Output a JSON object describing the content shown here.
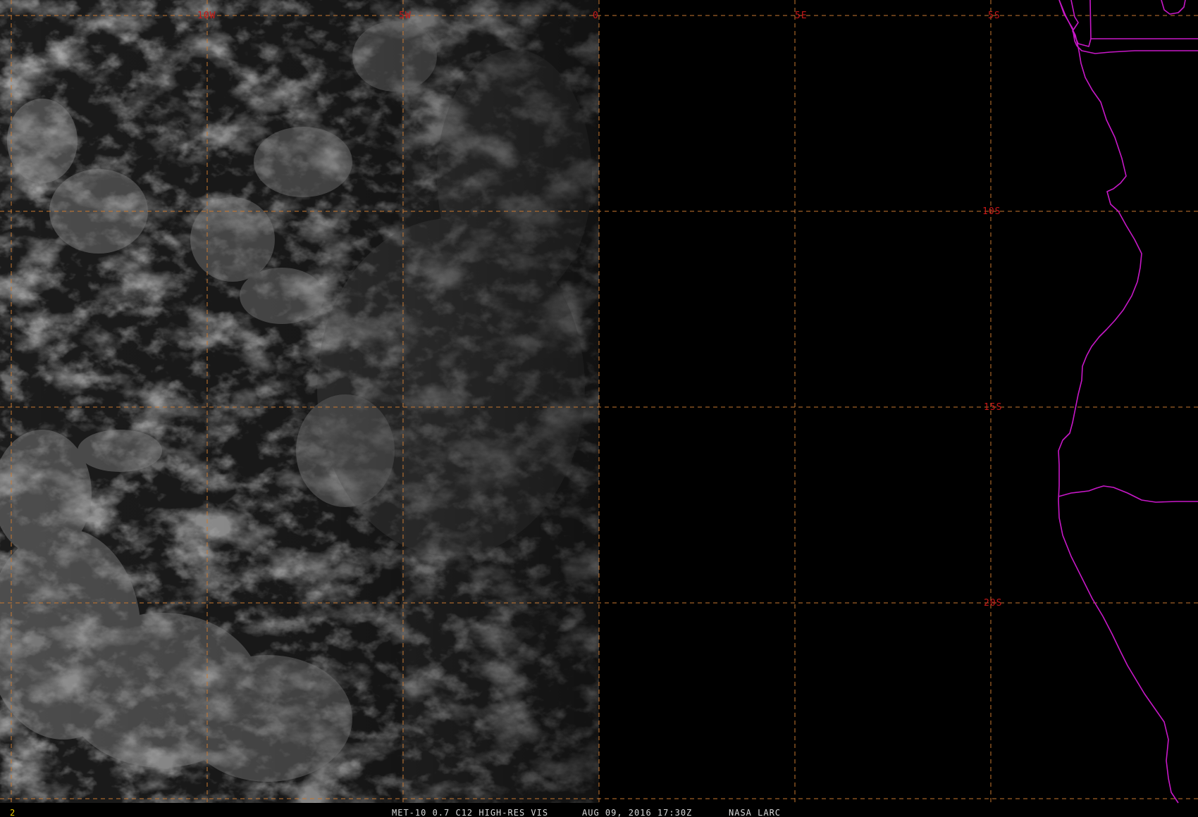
{
  "image": {
    "product": "MET-10 0.7 C12 HIGH-RES VIS",
    "datetime": "AUG 09, 2016 17:30Z",
    "source": "NASA LARC",
    "frame_number": "2"
  },
  "graticule": {
    "longitude_labels": [
      "10W",
      "5W",
      "0",
      "5E"
    ],
    "latitude_labels": [
      "5S",
      "10S",
      "15S",
      "20S"
    ],
    "line_color": "#c87830",
    "label_color": "#c81818"
  },
  "overlay": {
    "map_outline_color": "#c818c8",
    "features": [
      "african-coastline",
      "country-borders"
    ]
  },
  "imagery": {
    "illumination": "daylight imagery west of terminator, night side black to the east",
    "feature": "cloud field over South Atlantic"
  }
}
